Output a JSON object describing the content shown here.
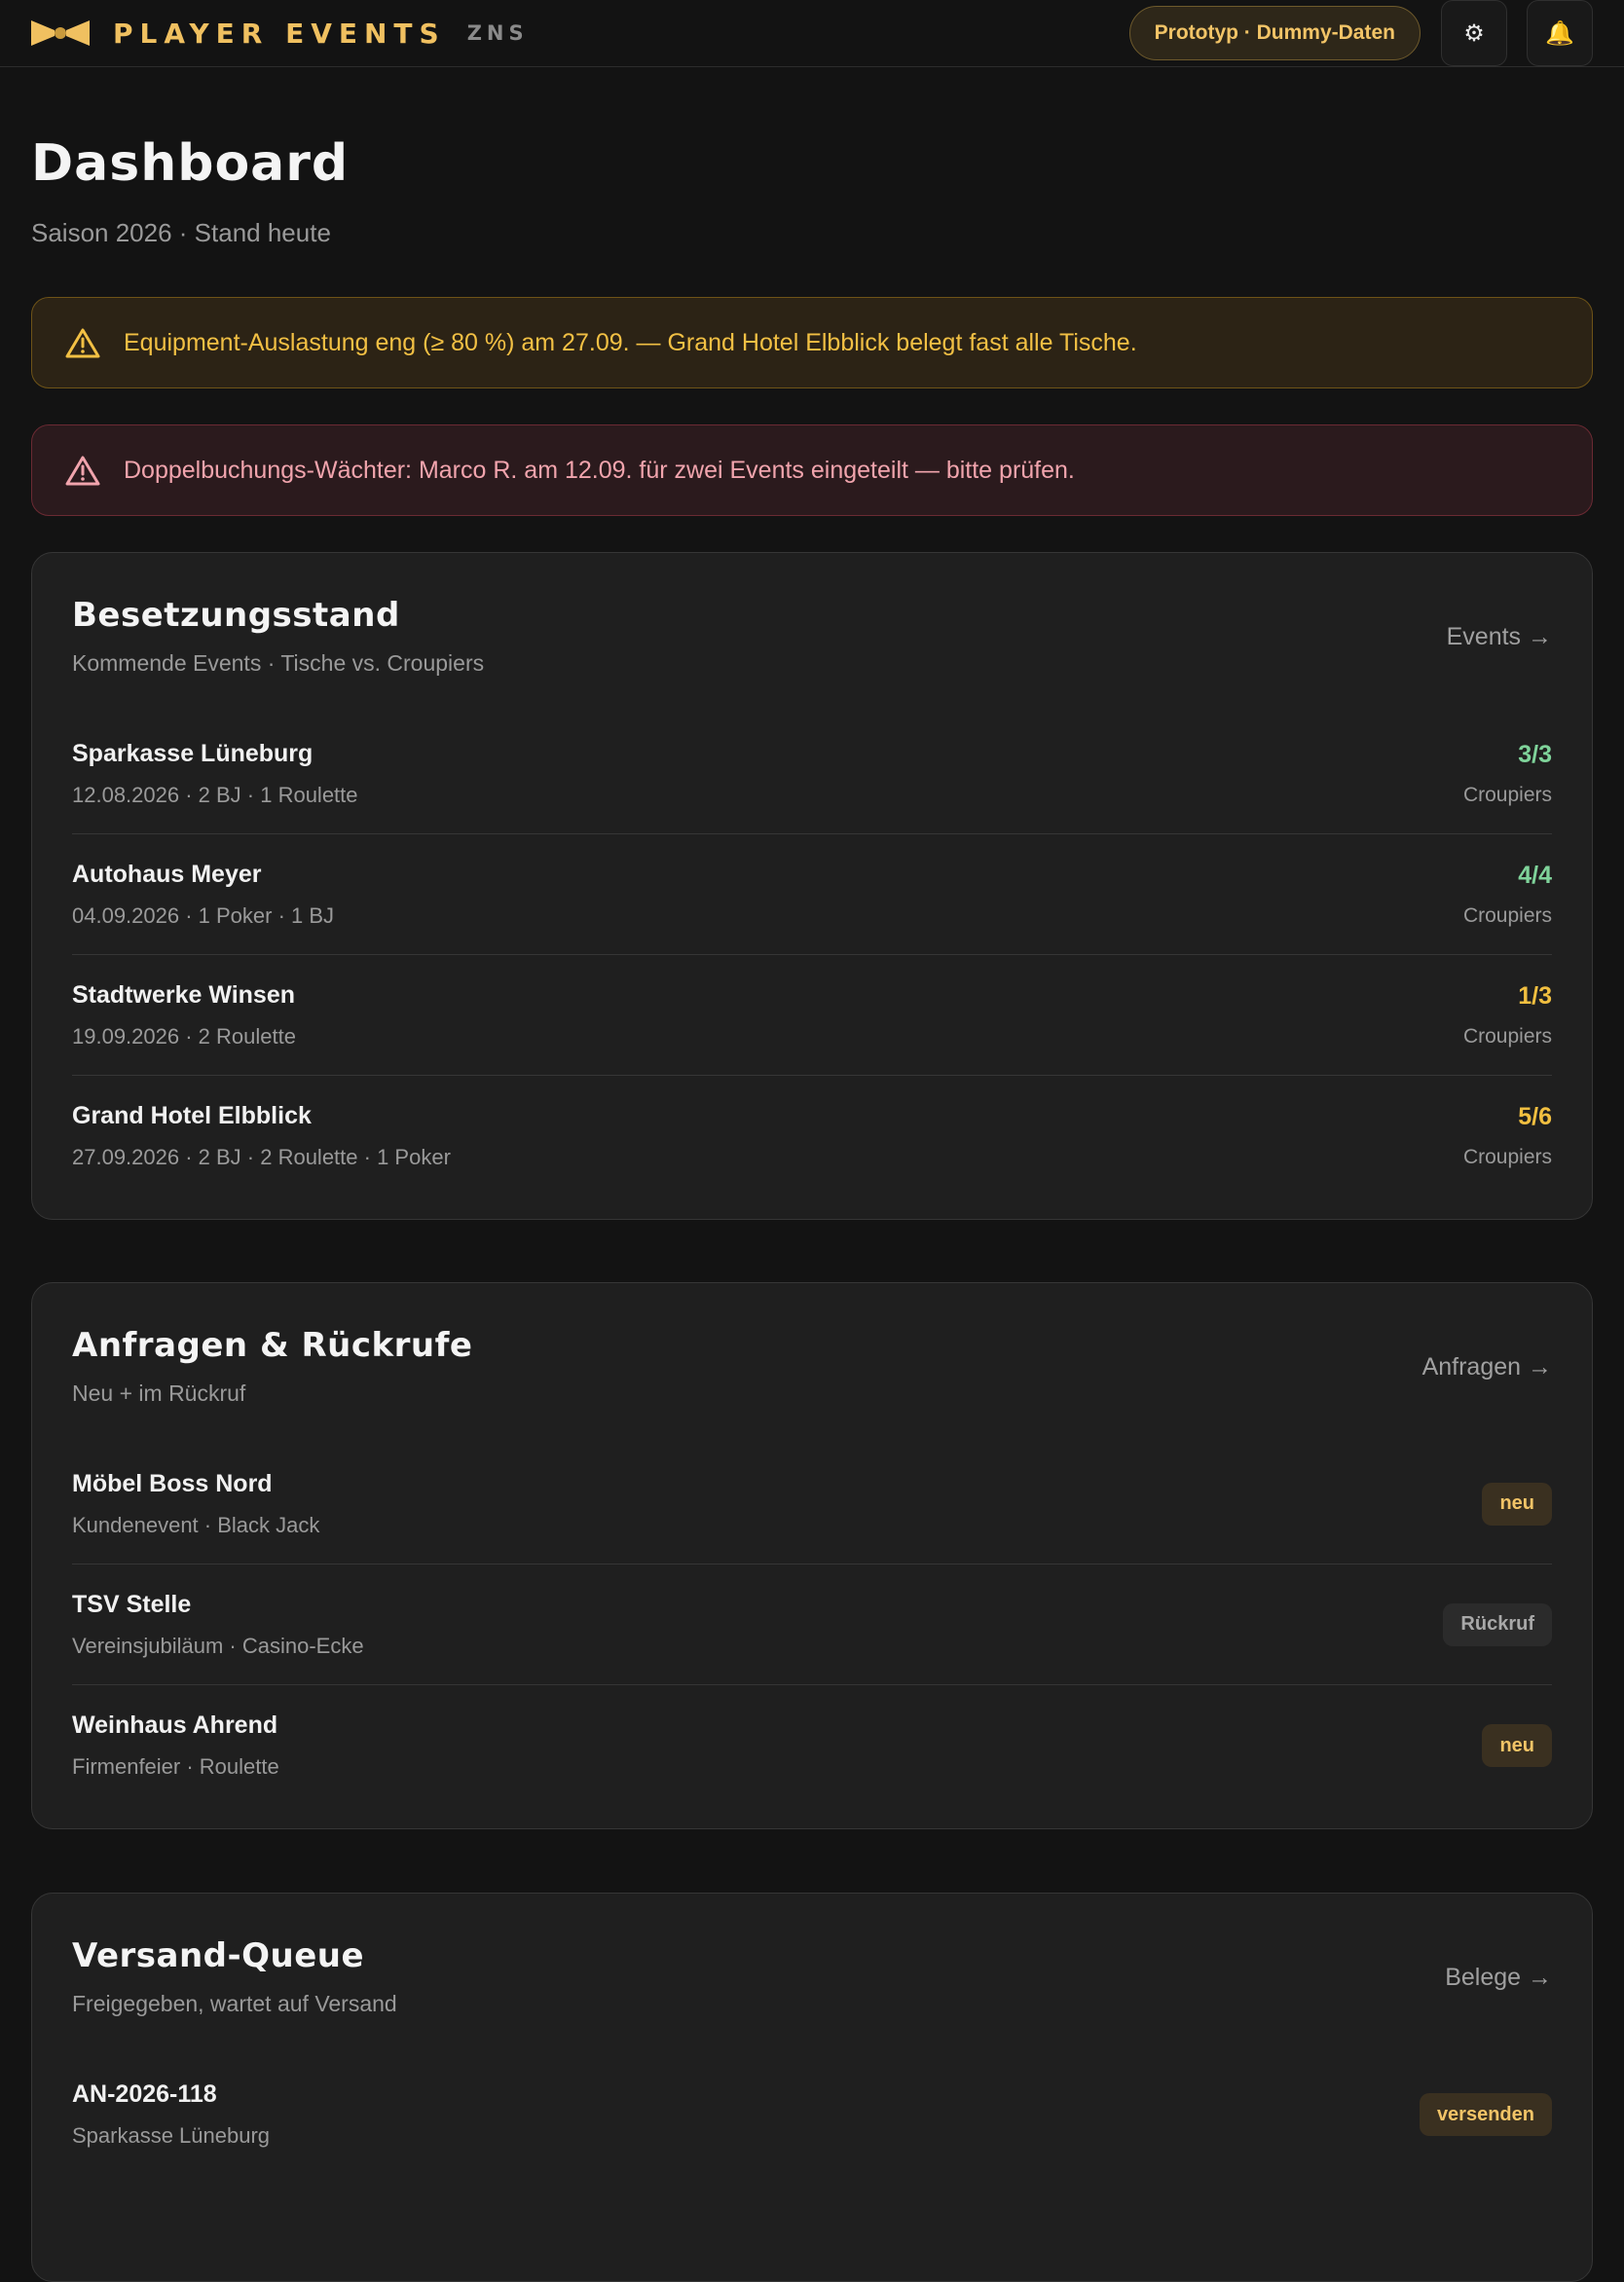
{
  "header": {
    "brand": "PLAYER EVENTS",
    "region": "ZNS",
    "prototype_badge": "Prototyp · Dummy-Daten",
    "settings_icon": "⚙",
    "notifications_icon": "🔔",
    "accent_color": "#f0c060"
  },
  "page": {
    "title": "Dashboard",
    "subtitle": "Saison 2026 · Stand heute"
  },
  "alerts": {
    "warning": {
      "icon": "warning-triangle-icon",
      "text": "Equipment-Auslastung eng (≥ 80 %) am 27.09. — Grand Hotel Elbblick belegt fast alle Tische."
    },
    "error": {
      "icon": "warning-triangle-icon",
      "text": "Doppelbuchungs-Wächter: Marco R. am 12.09. für zwei Events eingeteilt — bitte prüfen."
    }
  },
  "staffing": {
    "title": "Besetzungsstand",
    "subtitle": "Kommende Events · Tische vs. Croupiers",
    "link": "Events →",
    "rows": [
      {
        "name": "Sparkasse Lüneburg",
        "meta": "12.08.2026 · 2 BJ · 1 Roulette",
        "ratio": "3/3",
        "ratio_label": "Croupiers",
        "status": "ok"
      },
      {
        "name": "Autohaus Meyer",
        "meta": "04.09.2026 · 1 Poker · 1 BJ",
        "ratio": "4/4",
        "ratio_label": "Croupiers",
        "status": "ok"
      },
      {
        "name": "Stadtwerke Winsen",
        "meta": "19.09.2026 · 2 Roulette",
        "ratio": "1/3",
        "ratio_label": "Croupiers",
        "status": "partial"
      },
      {
        "name": "Grand Hotel Elbblick",
        "meta": "27.09.2026 · 2 BJ · 2 Roulette · 1 Poker",
        "ratio": "5/6",
        "ratio_label": "Croupiers",
        "status": "partial"
      }
    ]
  },
  "requests": {
    "title": "Anfragen & Rückrufe",
    "subtitle": "Neu + im Rückruf",
    "link": "Anfragen →",
    "rows": [
      {
        "name": "Möbel Boss Nord",
        "meta": "Kundenevent · Black Jack",
        "badge": "neu",
        "badge_type": "new"
      },
      {
        "name": "TSV Stelle",
        "meta": "Vereinsjubiläum · Casino-Ecke",
        "badge": "Rückruf",
        "badge_type": "call"
      },
      {
        "name": "Weinhaus Ahrend",
        "meta": "Firmenfeier · Roulette",
        "badge": "neu",
        "badge_type": "new"
      }
    ]
  },
  "queue": {
    "title": "Versand-Queue",
    "subtitle": "Freigegeben, wartet auf Versand",
    "link": "Belege →",
    "rows": [
      {
        "name": "AN-2026-118",
        "meta": "Sparkasse Lüneburg",
        "badge": "versenden",
        "badge_type": "ship"
      }
    ]
  }
}
